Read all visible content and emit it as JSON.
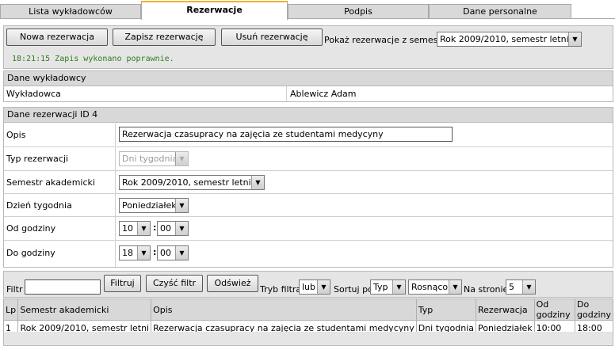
{
  "tabs": [
    {
      "label": "Lista wykładowców",
      "active": false
    },
    {
      "label": "Rezerwacje",
      "active": true
    },
    {
      "label": "Podpis",
      "active": false
    },
    {
      "label": "Dane personalne",
      "active": false
    }
  ],
  "toolbar": {
    "new_label": "Nowa rezerwacja",
    "save_label": "Zapisz rezerwację",
    "delete_label": "Usuń rezerwację",
    "semester_filter_label": "Pokaż rezerwacje z semestru",
    "semester_filter_value": "Rok 2009/2010, semestr letni",
    "status_message": "18:21:15 Zapis wykonano poprawnie."
  },
  "lecturer_panel": {
    "title": "Dane wykładowcy",
    "field_label": "Wykładowca",
    "field_value": "Ablewicz Adam"
  },
  "reservation_panel": {
    "title": "Dane rezerwacji ID 4",
    "description_label": "Opis",
    "description_value": "Rezerwacja czasupracy na zajęcia ze studentami medycyny",
    "type_label": "Typ rezerwacji",
    "type_value": "Dni tygodnia",
    "semester_label": "Semestr akademicki",
    "semester_value": "Rok 2009/2010, semestr letni",
    "weekday_label": "Dzień tygodnia",
    "weekday_value": "Poniedziałek",
    "from_label": "Od godziny",
    "from_hour": "10",
    "from_minute": "00",
    "to_label": "Do godziny",
    "to_hour": "18",
    "to_minute": "00",
    "time_separator": ":"
  },
  "filter": {
    "label": "Filtr",
    "value": "",
    "filter_btn": "Filtruj",
    "clear_btn": "Czyść filtr",
    "refresh_btn": "Odśwież",
    "mode_label": "Tryb filtra",
    "mode_value": "lub",
    "sort_label": "Sortuj po",
    "sort_value": "Typ",
    "order_value": "Rosnąco",
    "per_page_label": "Na stronie",
    "per_page_value": "5"
  },
  "table": {
    "headers": [
      "Lp",
      "Semestr akademicki",
      "Opis",
      "Typ",
      "Rezerwacja",
      "Od godziny",
      "Do godziny"
    ],
    "rows": [
      [
        "1",
        "Rok 2009/2010, semestr letni",
        "Rezerwacja czasupracy na zajęcia ze studentami medycyny",
        "Dni tygodnia",
        "Poniedziałek",
        "10:00",
        "18:00"
      ]
    ]
  },
  "icons": {
    "dropdown": "chevron-down-icon"
  }
}
